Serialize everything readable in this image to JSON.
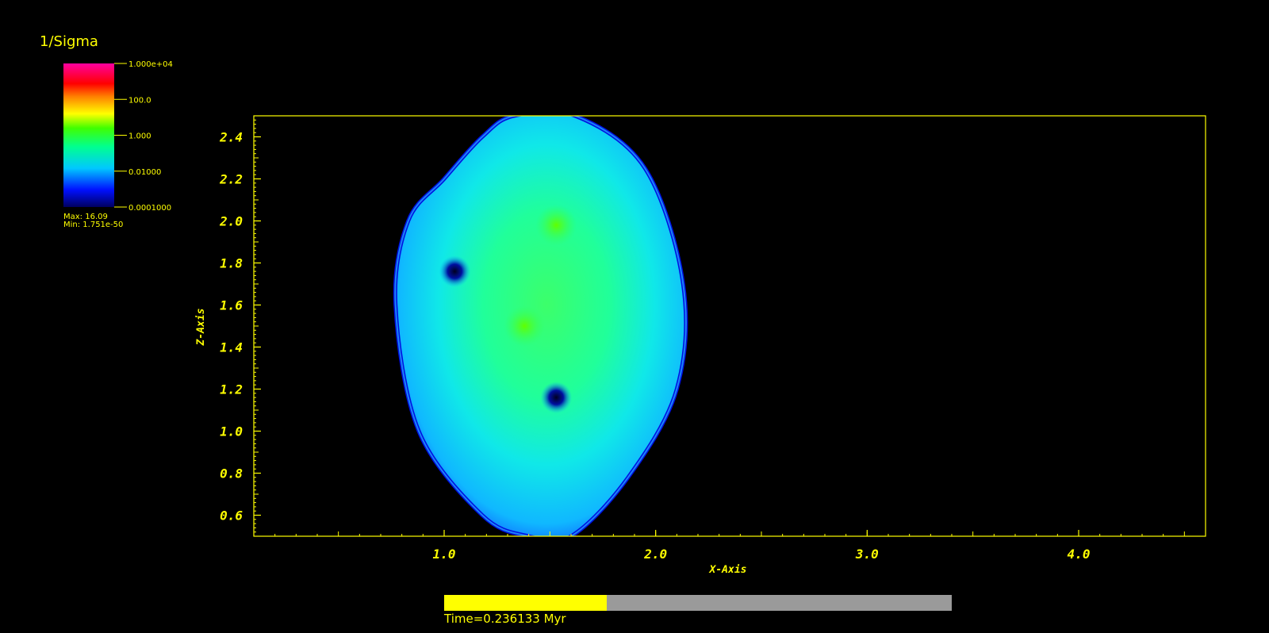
{
  "colors": {
    "axis": "#ffff00",
    "background": "#000000",
    "bar_track": "#9a9a9a",
    "bar_fill": "#ffff00"
  },
  "legend": {
    "title": "1/Sigma",
    "scale": "log",
    "tick_labels": [
      "1.000e+04",
      "100.0",
      "1.000",
      "0.01000",
      "0.0001000"
    ],
    "tick_values": [
      10000,
      100,
      1,
      0.01,
      0.0001
    ],
    "max_label": "Max:  16.09",
    "min_label": "Min:  1.751e-50"
  },
  "time": {
    "label": "Time=0.236133 Myr",
    "progress": 0.32
  },
  "chart_data": {
    "type": "heatmap",
    "title": "",
    "variable": "1/Sigma",
    "xlabel": "X-Axis",
    "ylabel": "Z-Axis",
    "xlim": [
      0.1,
      4.6
    ],
    "ylim": [
      0.5,
      2.5
    ],
    "xticks": [
      1.0,
      2.0,
      3.0,
      4.0
    ],
    "xtick_labels": [
      "1.0",
      "2.0",
      "3.0",
      "4.0"
    ],
    "yticks": [
      0.6,
      0.8,
      1.0,
      1.2,
      1.4,
      1.6,
      1.8,
      2.0,
      2.2,
      2.4
    ],
    "ytick_labels": [
      "0.6",
      "0.8",
      "1.0",
      "1.2",
      "1.4",
      "1.6",
      "1.8",
      "2.0",
      "2.2",
      "2.4"
    ],
    "colormap": "blue-cyan-green-yellow-red-magenta",
    "color_scale": "log",
    "color_range": [
      0.0001,
      10000
    ],
    "grid": false,
    "region": {
      "description_points_x": [
        1.0,
        1.18,
        1.33,
        1.62,
        1.95,
        2.13,
        2.1,
        1.87,
        1.6,
        1.4,
        1.18,
        0.88,
        0.77,
        0.83
      ],
      "description_points_y": [
        2.2,
        2.4,
        2.5,
        2.5,
        2.25,
        1.7,
        1.2,
        0.78,
        0.5,
        0.5,
        0.6,
        1.0,
        1.6,
        2.0
      ]
    },
    "features": [
      {
        "x": 1.53,
        "y": 1.98,
        "value": 1.0
      },
      {
        "x": 1.05,
        "y": 1.76,
        "value": 0.0001
      },
      {
        "x": 1.53,
        "y": 1.16,
        "value": 0.0001
      },
      {
        "x": 1.38,
        "y": 1.5,
        "value": 1.0
      }
    ]
  }
}
